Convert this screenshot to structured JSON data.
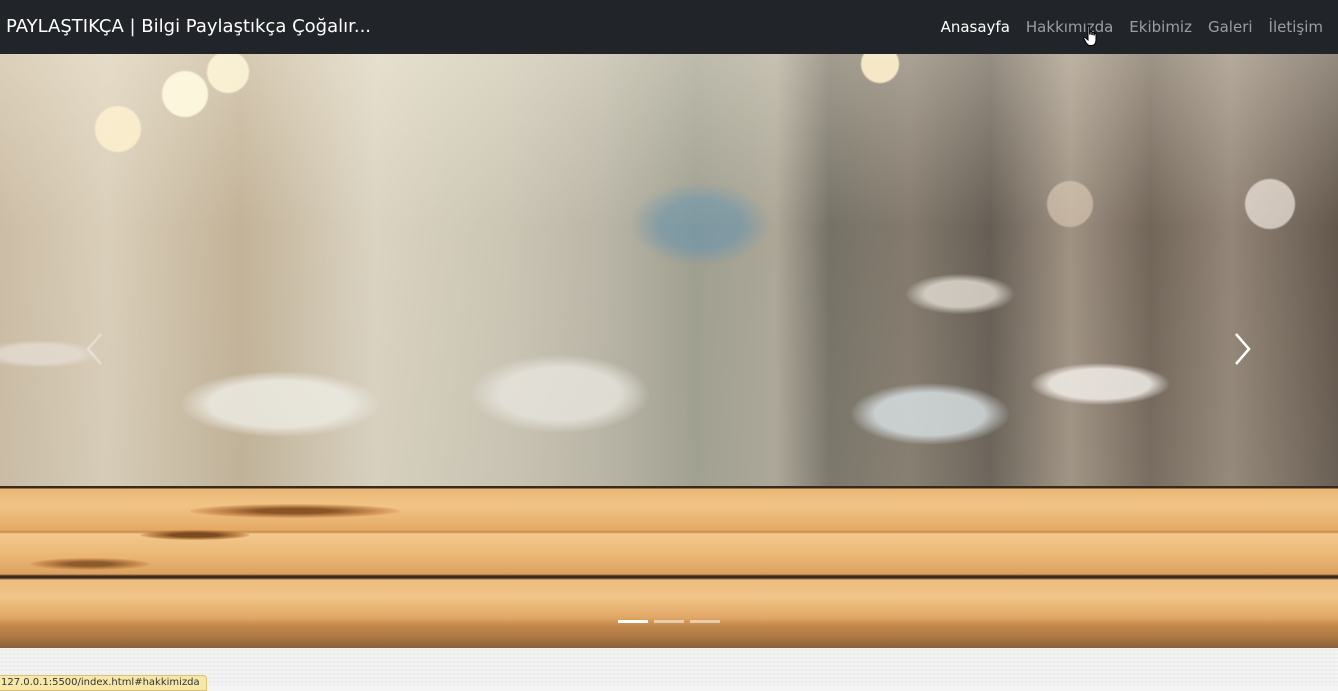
{
  "navbar": {
    "brand": "PAYLAŞTIKÇA | Bilgi Paylaştıkça Çoğalır...",
    "links": [
      {
        "label": "Anasayfa",
        "active": true
      },
      {
        "label": "Hakkımızda",
        "active": false
      },
      {
        "label": "Ekibimiz",
        "active": false
      },
      {
        "label": "Galeri",
        "active": false
      },
      {
        "label": "İletişim",
        "active": false
      }
    ]
  },
  "carousel": {
    "prev_icon": "chevron-left-icon",
    "next_icon": "chevron-right-icon",
    "slide_count": 3,
    "active_slide": 1
  },
  "status_bar": {
    "url": "127.0.0.1:5500/index.html#hakkimizda"
  },
  "colors": {
    "navbar_bg": "#212529",
    "link_active": "#ffffff",
    "link_inactive": "rgba(255,255,255,0.55)"
  }
}
